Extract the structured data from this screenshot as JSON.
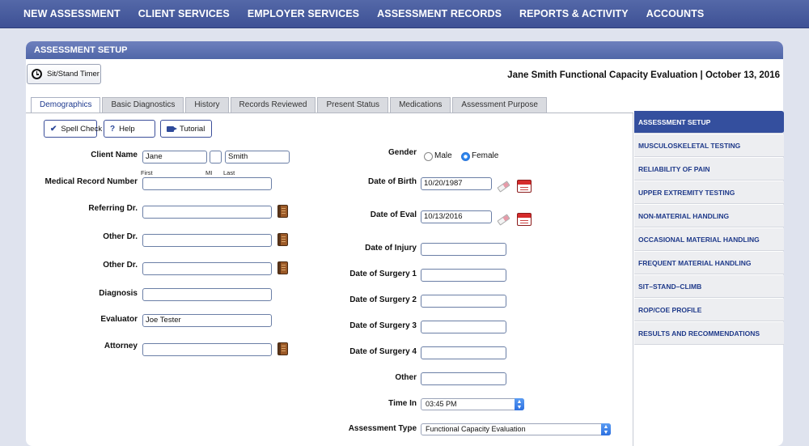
{
  "topnav": [
    "NEW ASSESSMENT",
    "CLIENT SERVICES",
    "EMPLOYER SERVICES",
    "ASSESSMENT RECORDS",
    "REPORTS & ACTIVITY",
    "ACCOUNTS"
  ],
  "panel": {
    "title": "ASSESSMENT SETUP",
    "timer_label": "Sit/Stand Timer",
    "eval_title": "Jane Smith Functional Capacity Evaluation | October 13, 2016"
  },
  "tabs": [
    "Demographics",
    "Basic Diagnostics",
    "History",
    "Records Reviewed",
    "Present Status",
    "Medications",
    "Assessment Purpose"
  ],
  "tools": {
    "spell": "Spell Check",
    "help": "Help",
    "tutorial": "Tutorial"
  },
  "left_form": {
    "client_name_label": "Client Name",
    "first": "Jane",
    "mi": "",
    "last": "Smith",
    "first_sub": "First",
    "mi_sub": "MI",
    "last_sub": "Last",
    "mrn_label": "Medical Record Number",
    "mrn": "",
    "referring_label": "Referring Dr.",
    "referring": "",
    "other1_label": "Other Dr.",
    "other1": "",
    "other2_label": "Other Dr.",
    "other2": "",
    "diagnosis_label": "Diagnosis",
    "diagnosis": "",
    "evaluator_label": "Evaluator",
    "evaluator": "Joe Tester",
    "attorney_label": "Attorney",
    "attorney": ""
  },
  "right_form": {
    "gender_label": "Gender",
    "male": "Male",
    "female": "Female",
    "gender_selected": "Female",
    "dob_label": "Date of Birth",
    "dob": "10/20/1987",
    "doe_label": "Date of Eval",
    "doe": "10/13/2016",
    "injury_label": "Date of Injury",
    "injury": "",
    "s1_label": "Date of Surgery 1",
    "s1": "",
    "s2_label": "Date of Surgery 2",
    "s2": "",
    "s3_label": "Date of Surgery 3",
    "s3": "",
    "s4_label": "Date of Surgery 4",
    "s4": "",
    "other_label": "Other",
    "other": "",
    "time_label": "Time In",
    "time": "03:45 PM",
    "type_label": "Assessment Type",
    "type": "Functional Capacity Evaluation"
  },
  "sidemenu": [
    "ASSESSMENT SETUP",
    "MUSCULOSKELETAL TESTING",
    "RELIABILITY OF PAIN",
    "UPPER EXTREMITY TESTING",
    "NON-MATERIAL HANDLING",
    "OCCASIONAL MATERIAL HANDLING",
    "FREQUENT MATERIAL HANDLING",
    "SIT–STAND–CLIMB",
    "ROP/COE PROFILE",
    "RESULTS AND RECOMMENDATIONS"
  ],
  "icons": {
    "timer": "clock-icon",
    "spell": "checkmark-icon",
    "help": "question-icon",
    "tutorial": "video-camera-icon",
    "lookup": "address-book-icon",
    "clear": "eraser-icon",
    "date": "calendar-icon",
    "select": "select-arrows-icon"
  },
  "colors": {
    "nav": "#4a5ea2",
    "accent": "#344f9e",
    "radio": "#2d86ee"
  }
}
